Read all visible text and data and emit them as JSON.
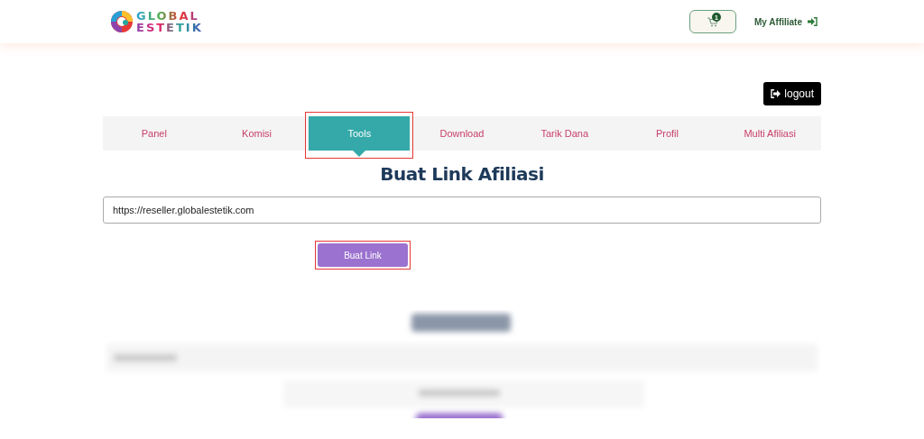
{
  "header": {
    "logo": {
      "line_1": "GLOBAL",
      "line_2": "ESTETIK"
    },
    "cart_count": "1",
    "account_link": "My Affiliate"
  },
  "logout_button": "logout",
  "tabs": [
    {
      "label": "Panel",
      "selected": false,
      "highlighted": false
    },
    {
      "label": "Komisi",
      "selected": false,
      "highlighted": false
    },
    {
      "label": "Tools",
      "selected": true,
      "highlighted": true
    },
    {
      "label": "Download",
      "selected": false,
      "highlighted": false
    },
    {
      "label": "Tarik Dana",
      "selected": false,
      "highlighted": false
    },
    {
      "label": "Profil",
      "selected": false,
      "highlighted": false
    },
    {
      "label": "Multi Afiliasi",
      "selected": false,
      "highlighted": false
    }
  ],
  "link_form": {
    "title": "Buat Link Afiliasi",
    "url_value": "https://reseller.globalestetik.com",
    "button": {
      "label": "Buat Link",
      "highlighted": true
    }
  },
  "banner_form": {
    "kind": "blurred"
  }
}
